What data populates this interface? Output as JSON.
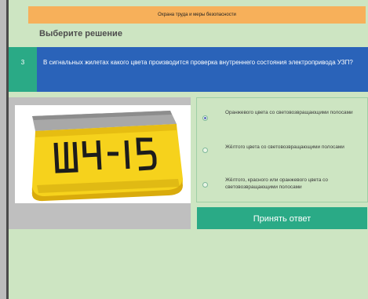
{
  "header": {
    "course_title": "Охрана труда и меры безопасности"
  },
  "page": {
    "title": "Выберите решение"
  },
  "question": {
    "number": "3",
    "text": "В сигнальных жилетах какого цвета производится проверка внутреннего состояния электропривода УЗП?"
  },
  "image": {
    "vest_label": "ШЧ-15",
    "vest_color": "#f6d21c",
    "stripe_color": "#a8a8a8"
  },
  "options": [
    {
      "label": "Оранжевого цвета со световозвращающими полосами",
      "selected": true
    },
    {
      "label": "Жёлтого цвета со световозвращающими полосами",
      "selected": false
    },
    {
      "label": "Жёлтого, красного или оранжевого цвета со световозвращающими полосами",
      "selected": false
    }
  ],
  "actions": {
    "submit_label": "Принять ответ"
  },
  "colors": {
    "background": "#cde5c2",
    "header": "#f7b05a",
    "question_bar": "#2a63b9",
    "accent": "#2aaa86"
  }
}
